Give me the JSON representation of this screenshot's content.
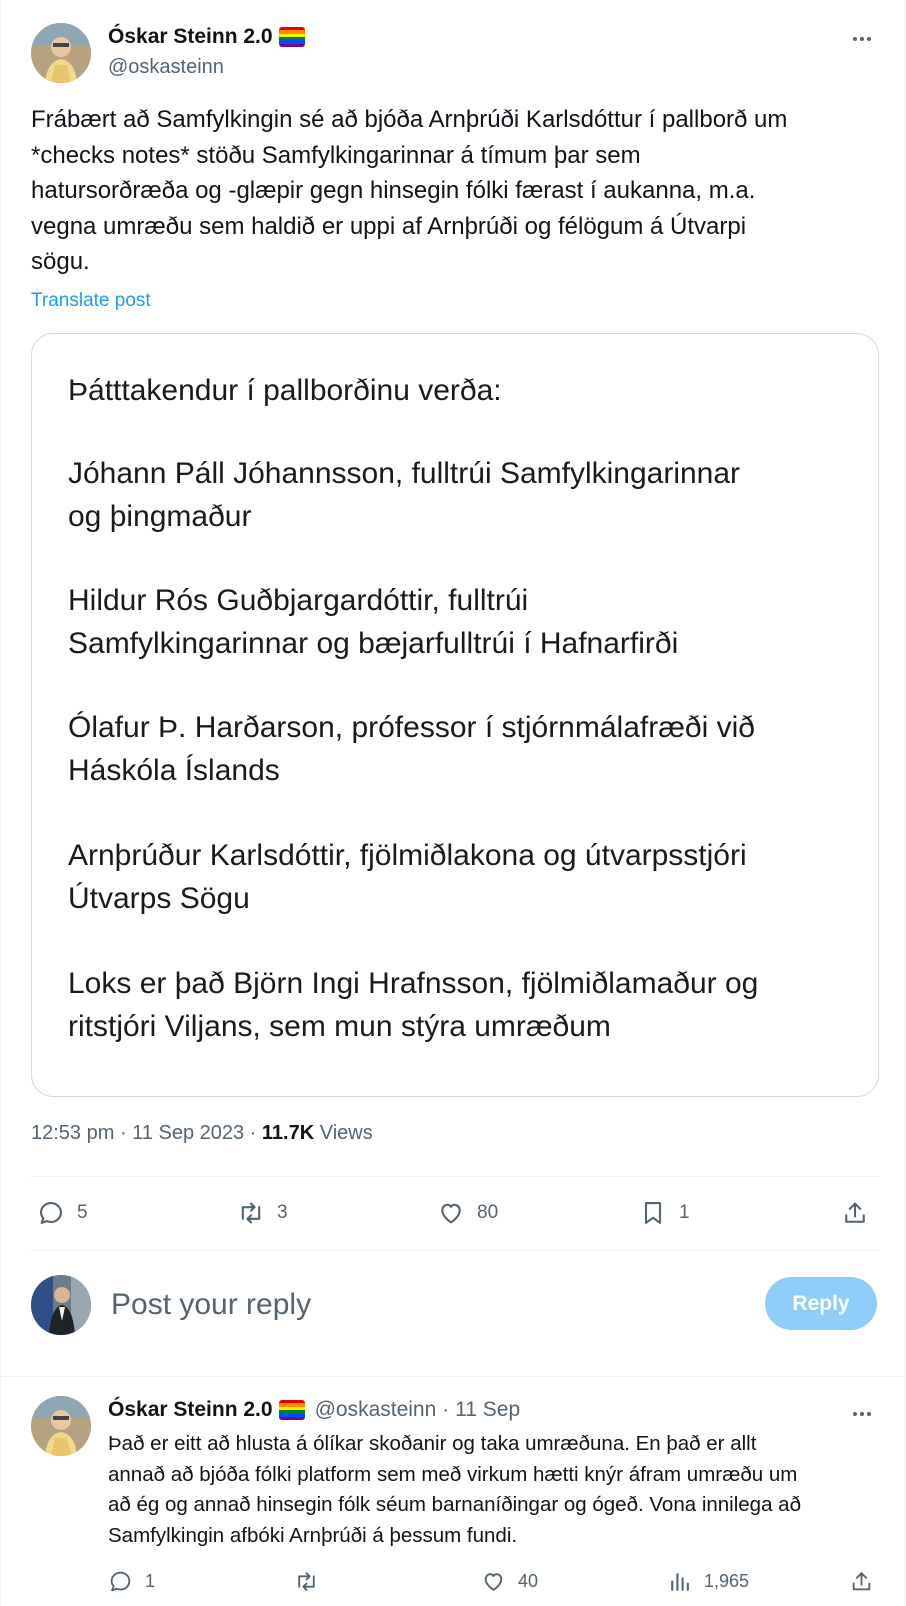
{
  "tweet": {
    "author_name": "Óskar Steinn 2.0",
    "author_handle": "@oskasteinn",
    "text_lines": [
      "Frábært að Samfylkingin sé að bjóða Arnþrúði Karlsdóttur í pallborð um",
      "*checks notes* stöðu Samfylkingarinnar á tímum þar sem",
      "hatursorðræða og -glæpir gegn hinsegin fólki færast í aukanna, m.a.",
      "vegna umræðu sem haldið er uppi af Arnþrúði og félögum á Útvarpi",
      "sögu."
    ],
    "translate_label": "Translate post",
    "media_lines": [
      "Þátttakendur í pallborðinu verða:",
      "Jóhann Páll Jóhannsson, fulltrúi Samfylkingarinnar",
      "og þingmaður",
      "Hildur Rós Guðbjargardóttir, fulltrúi",
      "Samfylkingarinnar og bæjarfulltrúi í Hafnarfirði",
      "Ólafur Þ. Harðarson, prófessor í stjórnmálafræði við",
      "Háskóla Íslands",
      "Arnþrúður Karlsdóttir, fjölmiðlakona og útvarpsstjóri",
      "Útvarps Sögu",
      "Loks er það Björn Ingi Hrafnsson, fjölmiðlamaður og",
      "ritstjóri Viljans, sem mun stýra umræðum"
    ],
    "time": "12:53 pm · 11 Sep 2023 · ",
    "views_count": "11.7K",
    "views_label": " Views",
    "stats": {
      "replies": "5",
      "reposts": "3",
      "likes": "80",
      "bookmarks": "1"
    }
  },
  "reply_box": {
    "placeholder": "Post your reply",
    "button_label": "Reply"
  },
  "reply": {
    "author_name": "Óskar Steinn 2.0",
    "author_handle": "@oskasteinn",
    "date": "· 11 Sep",
    "text_lines": [
      "Það er eitt að hlusta á ólíkar skoðanir og taka umræðuna. En það er allt",
      "annað að bjóða fólki platform sem með virkum hætti knýr áfram umræðu um",
      "að ég og annað hinsegin fólk séum barnaníðingar og ógeð. Vona innilega að",
      "Samfylkingin afbóki Arnþrúði á þessum fundi."
    ],
    "stats": {
      "replies": "1",
      "likes": "40",
      "views": "1,965"
    }
  },
  "icons": [
    "more-icon",
    "pride-flag-icon",
    "reply-icon",
    "repost-icon",
    "like-icon",
    "bookmark-icon",
    "share-icon",
    "views-icon"
  ],
  "colors": {
    "link": "#1d9bf0",
    "muted": "#536471",
    "reply_button": "#8ecdf7",
    "text": "#0f1419"
  }
}
